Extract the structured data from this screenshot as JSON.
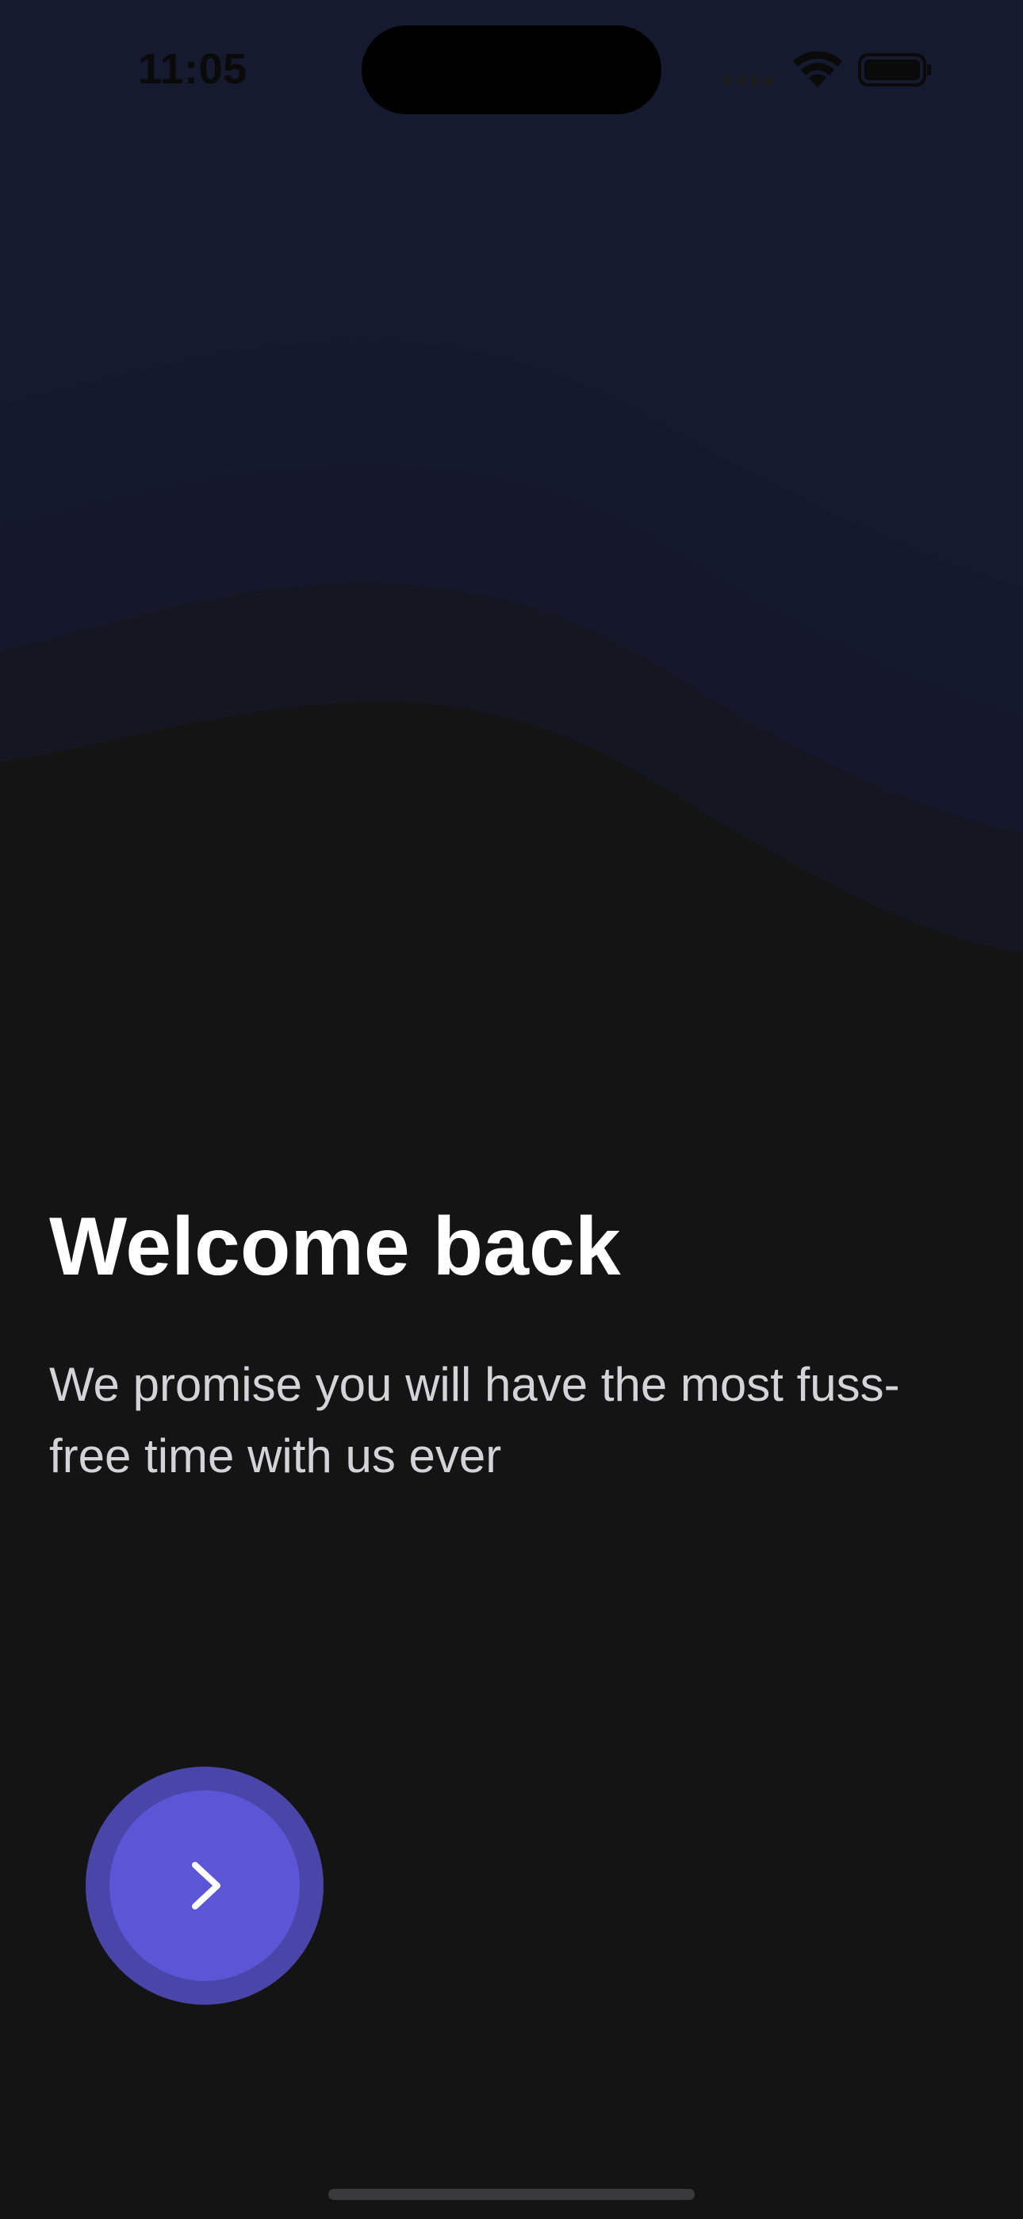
{
  "status_bar": {
    "time": "11:05"
  },
  "onboarding": {
    "title": "Welcome back",
    "subtitle": "We promise you will have the most fuss-free time with us ever",
    "next_button_icon": "chevron-right-icon"
  },
  "colors": {
    "background": "#141414",
    "accent": "#5b56d6",
    "accent_ring": "#4a45a8",
    "title_text": "#ffffff",
    "subtitle_text": "#d4d4d8",
    "wave_top": "#151a2e"
  }
}
